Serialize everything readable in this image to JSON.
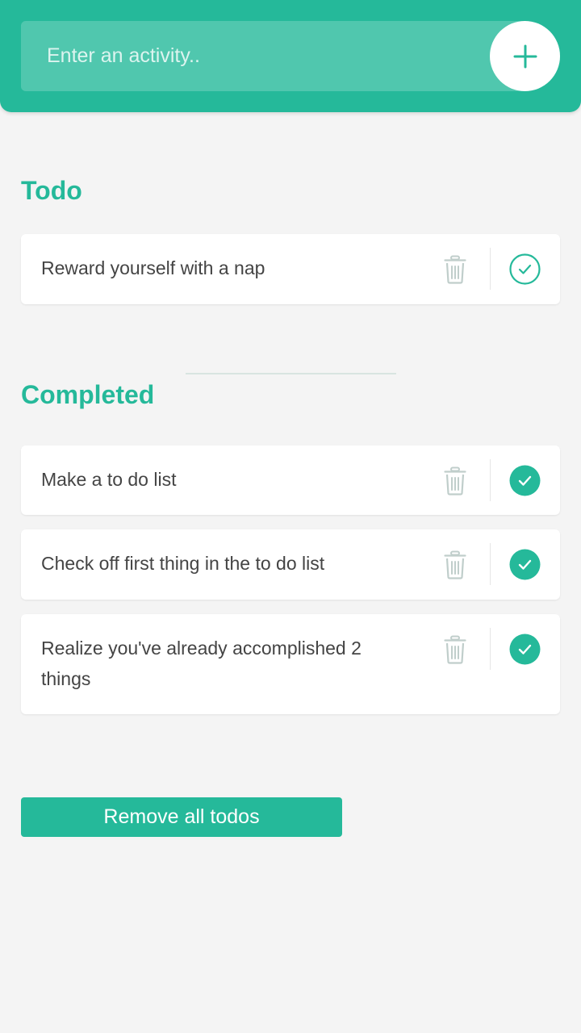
{
  "header": {
    "input_placeholder": "Enter an activity..",
    "input_value": "",
    "add_icon": "plus-icon"
  },
  "todo_section": {
    "title": "Todo",
    "items": [
      {
        "text": "Reward yourself with a nap",
        "completed": false
      }
    ]
  },
  "completed_section": {
    "title": "Completed",
    "items": [
      {
        "text": "Make a to do list",
        "completed": true
      },
      {
        "text": "Check off first thing in the to do list",
        "completed": true
      },
      {
        "text": "Realize you've already accomplished 2 things",
        "completed": true
      }
    ]
  },
  "footer": {
    "remove_all_label": "Remove all todos"
  },
  "colors": {
    "accent": "#25b99a",
    "background": "#f4f4f4",
    "text": "#444444",
    "trash_icon": "#c0cecb"
  },
  "icons": {
    "delete": "trash-icon",
    "complete": "check-circle-icon"
  }
}
